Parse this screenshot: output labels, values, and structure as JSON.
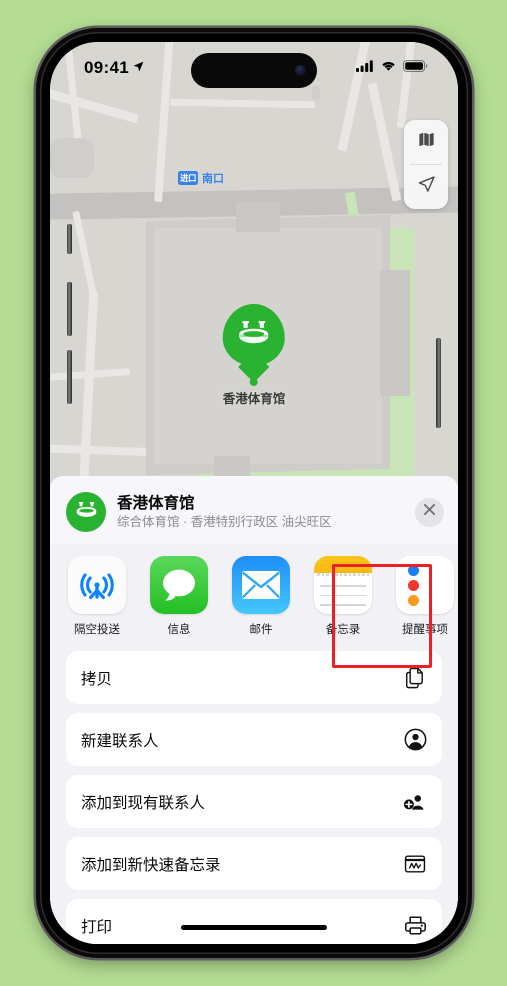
{
  "background": {
    "color": "#b4dd93"
  },
  "status_bar": {
    "time": "09:41",
    "location_icon": "location-arrow-icon",
    "cellular_icon": "cellular-bars-icon",
    "wifi_icon": "wifi-icon",
    "battery_icon": "battery-full-icon"
  },
  "map": {
    "poi_badge": "进口",
    "poi_label": "南口",
    "pin_label": "香港体育馆",
    "pin_color": "#2ab231",
    "controls": [
      {
        "name": "map-layers-button",
        "icon": "map-icon"
      },
      {
        "name": "locate-me-button",
        "icon": "location-arrow-icon"
      }
    ]
  },
  "share_sheet": {
    "title": "香港体育馆",
    "subtitle": "综合体育馆 · 香港特别行政区 油尖旺区",
    "close_icon": "close-icon",
    "avatar_icon": "stadium-icon",
    "apps": [
      {
        "label": "隔空投送",
        "icon": "airdrop-icon",
        "highlighted": false
      },
      {
        "label": "信息",
        "icon": "messages-icon",
        "highlighted": false
      },
      {
        "label": "邮件",
        "icon": "mail-icon",
        "highlighted": false
      },
      {
        "label": "备忘录",
        "icon": "notes-icon",
        "highlighted": true
      },
      {
        "label": "提醒事项",
        "icon": "reminders-icon",
        "highlighted": false
      }
    ],
    "highlight_color": "#ec2024",
    "actions": [
      {
        "label": "拷贝",
        "icon": "doc-on-doc-icon"
      },
      {
        "label": "新建联系人",
        "icon": "person-circle-icon"
      },
      {
        "label": "添加到现有联系人",
        "icon": "person-badge-plus-icon"
      },
      {
        "label": "添加到新快速备忘录",
        "icon": "quick-note-icon"
      },
      {
        "label": "打印",
        "icon": "printer-icon"
      }
    ]
  }
}
